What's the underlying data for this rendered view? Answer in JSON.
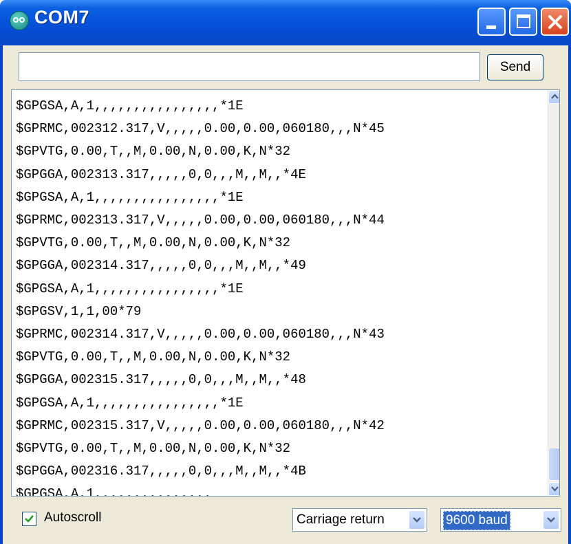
{
  "window": {
    "title": "COM7",
    "icon": "arduino-icon",
    "accent": "#0646c6"
  },
  "send_bar": {
    "input_value": "",
    "send_label": "Send"
  },
  "console": {
    "lines": [
      "$GPGSA,A,1,,,,,,,,,,,,,,,,*1E",
      "$GPRMC,002312.317,V,,,,,0.00,0.00,060180,,,N*45",
      "$GPVTG,0.00,T,,M,0.00,N,0.00,K,N*32",
      "$GPGGA,002313.317,,,,,0,0,,,M,,M,,*4E",
      "$GPGSA,A,1,,,,,,,,,,,,,,,,*1E",
      "$GPRMC,002313.317,V,,,,,0.00,0.00,060180,,,N*44",
      "$GPVTG,0.00,T,,M,0.00,N,0.00,K,N*32",
      "$GPGGA,002314.317,,,,,0,0,,,M,,M,,*49",
      "$GPGSA,A,1,,,,,,,,,,,,,,,,*1E",
      "$GPGSV,1,1,00*79",
      "$GPRMC,002314.317,V,,,,,0.00,0.00,060180,,,N*43",
      "$GPVTG,0.00,T,,M,0.00,N,0.00,K,N*32",
      "$GPGGA,002315.317,,,,,0,0,,,M,,M,,*48",
      "$GPGSA,A,1,,,,,,,,,,,,,,,,*1E",
      "$GPRMC,002315.317,V,,,,,0.00,0.00,060180,,,N*42",
      "$GPVTG,0.00,T,,M,0.00,N,0.00,K,N*32",
      "$GPGGA,002316.317,,,,,0,0,,,M,,M,,*4B",
      "$GPGSA,A,1,,,,,,,,,,,,,,,"
    ]
  },
  "footer": {
    "autoscroll_label": "Autoscroll",
    "autoscroll_checked": true,
    "line_ending": "Carriage return",
    "baud": "9600 baud"
  }
}
